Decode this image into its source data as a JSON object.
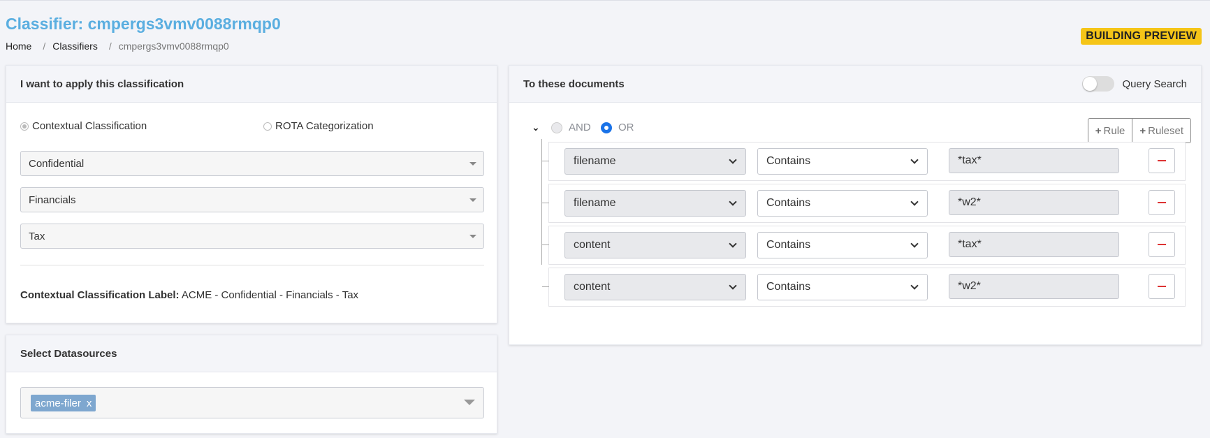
{
  "header": {
    "title": "Classifier: cmpergs3vmv0088rmqp0",
    "breadcrumb": [
      "Home",
      "Classifiers",
      "cmpergs3vmv0088rmqp0"
    ],
    "badge": "BUILDING PREVIEW"
  },
  "classification": {
    "heading": "I want to apply this classification",
    "options": [
      "Contextual Classification",
      "ROTA Categorization"
    ],
    "selected_option": "Contextual Classification",
    "selects": [
      "Confidential",
      "Financials",
      "Tax"
    ],
    "label_caption": "Contextual Classification Label:",
    "label_value": "ACME - Confidential - Financials - Tax"
  },
  "datasources": {
    "heading": "Select Datasources",
    "tags": [
      {
        "label": "acme-filer",
        "remove": "x"
      }
    ]
  },
  "documents": {
    "heading": "To these documents",
    "toggle_label": "Query Search",
    "toggle_on": false,
    "conditions": [
      "AND",
      "OR"
    ],
    "selected_condition": "OR",
    "add_rule": "Rule",
    "add_ruleset": "Ruleset",
    "rules": [
      {
        "field": "filename",
        "operator": "Contains",
        "value": "*tax*"
      },
      {
        "field": "filename",
        "operator": "Contains",
        "value": "*w2*"
      },
      {
        "field": "content",
        "operator": "Contains",
        "value": "*tax*"
      },
      {
        "field": "content",
        "operator": "Contains",
        "value": "*w2*"
      }
    ]
  },
  "colors": {
    "title": "#5aaee0",
    "badge_bg": "#f5c518",
    "tag_bg": "#7ea7cf",
    "radio_selected": "#1a73e8",
    "delete_icon": "#dd3333"
  }
}
